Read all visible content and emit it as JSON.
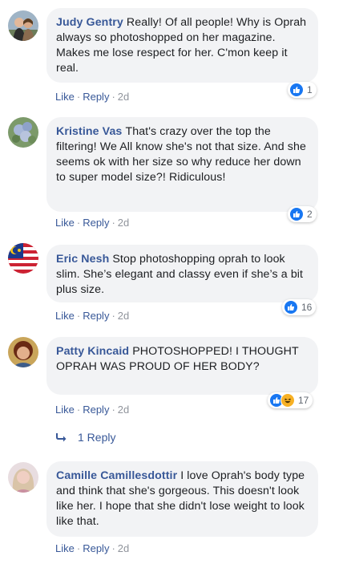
{
  "comments": [
    {
      "author": "Judy Gentry",
      "text": "Really! Of all people! Why is Oprah always so photoshopped on her magazine. Makes me lose respect for her. C'mon keep it real.",
      "reaction_count": "1",
      "like": "Like",
      "reply": "Reply",
      "time": "2d"
    },
    {
      "author": "Kristine Vas",
      "text": "That's crazy over the top the filtering! We All know she's not that size. And she seems ok with her size so why reduce her down to super model size?! Ridiculous!",
      "reaction_count": "2",
      "like": "Like",
      "reply": "Reply",
      "time": "2d"
    },
    {
      "author": "Eric Nesh",
      "text": "Stop photoshopping oprah to look slim. She’s elegant and classy even if she’s a bit plus size.",
      "reaction_count": "16",
      "like": "Like",
      "reply": "Reply",
      "time": "2d"
    },
    {
      "author": "Patty Kincaid",
      "text": "PHOTOSHOPPED! I THOUGHT OPRAH WAS PROUD OF HER BODY?",
      "reaction_count": "17",
      "like": "Like",
      "reply": "Reply",
      "time": "2d",
      "replies_label": "1 Reply"
    },
    {
      "author": "Camille Camillesdottir",
      "text": "I love Oprah's body type and think that she's gorgeous. This doesn't look like her. I hope that she didn't lose weight to look like that.",
      "like": "Like",
      "reply": "Reply",
      "time": "2d"
    }
  ],
  "separator": "·",
  "colors": {
    "author": "#385898",
    "bubble": "#f2f3f5",
    "like_blue": "#1877f2",
    "haha_yellow": "#f7b125",
    "meta_gray": "#90949c"
  },
  "icons": [
    "avatar",
    "like-reaction-icon",
    "haha-reaction-icon",
    "reply-arrow-icon"
  ]
}
